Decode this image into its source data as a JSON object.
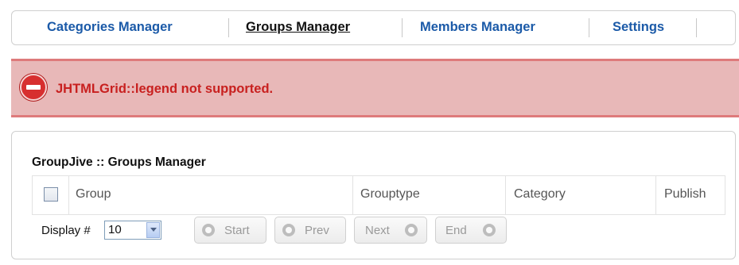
{
  "nav": {
    "items": [
      {
        "label": "Categories Manager",
        "active": false
      },
      {
        "label": "Groups Manager",
        "active": true
      },
      {
        "label": "Members Manager",
        "active": false
      },
      {
        "label": "Settings",
        "active": false
      }
    ]
  },
  "error": {
    "icon": "error-stop-icon",
    "message": "JHTMLGrid::legend not supported."
  },
  "panel": {
    "title": "GroupJive :: Groups Manager",
    "columns": [
      "Group",
      "Grouptype",
      "Category",
      "Publish"
    ],
    "pagination": {
      "display_label": "Display #",
      "display_value": "10",
      "start": "Start",
      "prev": "Prev",
      "next": "Next",
      "end": "End"
    }
  },
  "colors": {
    "nav_link": "#1b5aa8",
    "error_bg": "#e8b8b8",
    "error_border": "#de7a7b",
    "error_text": "#c8201f"
  }
}
